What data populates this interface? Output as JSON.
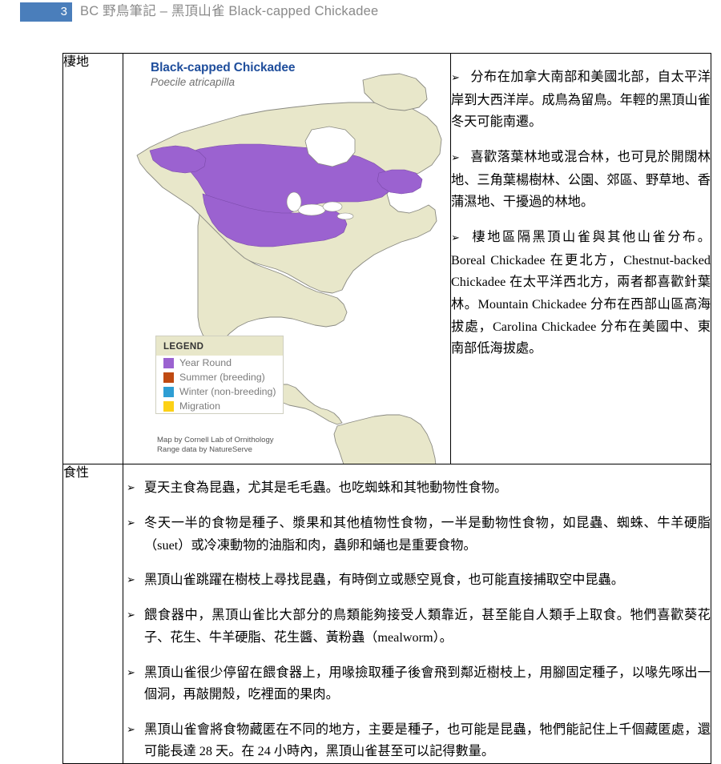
{
  "header": {
    "page_number": "3",
    "title": "BC 野鳥筆記 – 黑頂山雀 Black-capped Chickadee",
    "page_box_color": "#4a7ebb",
    "title_color": "#8a8a8a"
  },
  "table": {
    "rows": [
      {
        "label": "棲地"
      },
      {
        "label": "食性"
      }
    ]
  },
  "range_map": {
    "title": "Black-capped Chickadee",
    "subtitle": "Poecile atricapilla",
    "title_color": "#1f4e9c",
    "land_color": "#e8e7ca",
    "border_color": "#8a8a82",
    "range_color": "#9b62d0",
    "legend": {
      "title": "LEGEND",
      "items": [
        {
          "label": "Year Round",
          "color": "#9b62d0"
        },
        {
          "label": "Summer (breeding)",
          "color": "#bf4a12"
        },
        {
          "label": "Winter (non-breeding)",
          "color": "#2e9ed4"
        },
        {
          "label": "Migration",
          "color": "#fcd116"
        }
      ]
    },
    "credits": [
      "Map by Cornell Lab of Ornithology",
      "Range data by NatureServe"
    ]
  },
  "habitat": {
    "bullet_glyph": "➢",
    "items": [
      "分布在加拿大南部和美國北部，自太平洋岸到大西洋岸。成鳥為留鳥。年輕的黑頂山雀冬天可能南遷。",
      "喜歡落葉林地或混合林，也可見於開闊林地、三角葉楊樹林、公園、郊區、野草地、香蒲濕地、干擾過的林地。",
      "棲地區隔黑頂山雀與其他山雀分布。Boreal Chickadee 在更北方，Chestnut-backed Chickadee 在太平洋西北方，兩者都喜歡針葉林。Mountain Chickadee 分布在西部山區高海拔處，Carolina Chickadee 分布在美國中、東南部低海拔處。"
    ]
  },
  "diet": {
    "bullet_glyph": "➢",
    "items": [
      "夏天主食為昆蟲，尤其是毛毛蟲。也吃蜘蛛和其牠動物性食物。",
      "冬天一半的食物是種子、漿果和其他植物性食物，一半是動物性食物，如昆蟲、蜘蛛、牛羊硬脂（suet）或冷凍動物的油脂和肉，蟲卵和蛹也是重要食物。",
      "黑頂山雀跳躍在樹枝上尋找昆蟲，有時倒立或懸空覓食，也可能直接捕取空中昆蟲。",
      "餵食器中，黑頂山雀比大部分的鳥類能夠接受人類靠近，甚至能自人類手上取食。牠們喜歡葵花子、花生、牛羊硬脂、花生醬、黃粉蟲（mealworm）。",
      "黑頂山雀很少停留在餵食器上，用喙撿取種子後會飛到鄰近樹枝上，用腳固定種子，以喙先啄出一個洞，再敲開殼，吃裡面的果肉。",
      "黑頂山雀會將食物藏匿在不同的地方，主要是種子，也可能是昆蟲，牠們能記住上千個藏匿處，還可能長達 28 天。在 24 小時內，黑頂山雀甚至可以記得數量。"
    ]
  }
}
